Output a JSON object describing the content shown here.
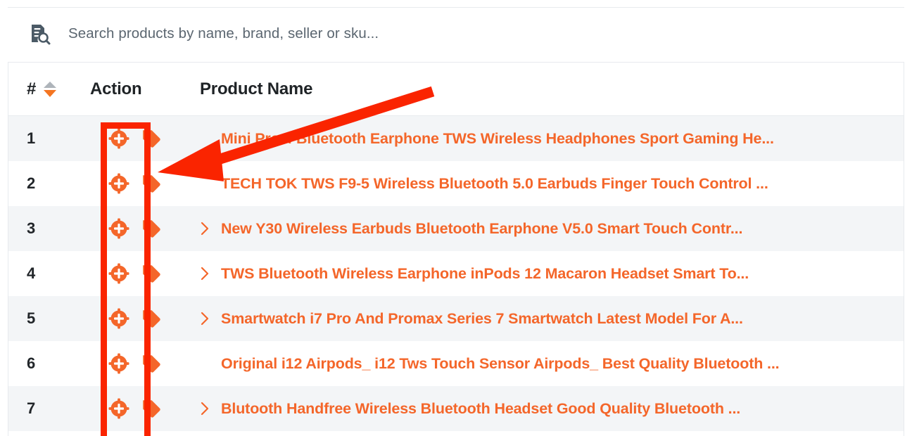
{
  "search": {
    "icon": "document-search-icon",
    "placeholder": "Search products by name, brand, seller or sku...",
    "value": ""
  },
  "table": {
    "columns": {
      "number": "#",
      "action": "Action",
      "product_name": "Product Name"
    },
    "sort": {
      "column": "#",
      "direction": "desc",
      "asc_color": "#aeb4ba",
      "desc_color": "#f47521"
    },
    "rows": [
      {
        "num": "1",
        "add_icon": "plus-circle-icon",
        "tag_icon": "tag-icon",
        "expandable": false,
        "name": "Mini Pro 4 Bluetooth Earphone TWS Wireless Headphones Sport Gaming He..."
      },
      {
        "num": "2",
        "add_icon": "plus-circle-icon",
        "tag_icon": "tag-icon",
        "expandable": false,
        "name": "TECH TOK TWS F9-5 Wireless Bluetooth 5.0 Earbuds Finger Touch Control ..."
      },
      {
        "num": "3",
        "add_icon": "plus-circle-icon",
        "tag_icon": "tag-icon",
        "expandable": true,
        "name": "New Y30 Wireless Earbuds Bluetooth Earphone V5.0 Smart Touch Contr..."
      },
      {
        "num": "4",
        "add_icon": "plus-circle-icon",
        "tag_icon": "tag-icon",
        "expandable": true,
        "name": "TWS Bluetooth Wireless Earphone inPods 12 Macaron Headset Smart To..."
      },
      {
        "num": "5",
        "add_icon": "plus-circle-icon",
        "tag_icon": "tag-icon",
        "expandable": true,
        "name": "Smartwatch i7 Pro And Promax Series 7 Smartwatch Latest Model For A..."
      },
      {
        "num": "6",
        "add_icon": "plus-circle-icon",
        "tag_icon": "tag-icon",
        "expandable": false,
        "name": "Original i12 Airpods_ i12 Tws Touch Sensor Airpods_ Best Quality Bluetooth ..."
      },
      {
        "num": "7",
        "add_icon": "plus-circle-icon",
        "tag_icon": "tag-icon",
        "expandable": true,
        "name": "Blutooth Handfree Wireless Bluetooth Headset Good Quality Bluetooth ..."
      }
    ]
  },
  "annotations": {
    "highlight_box": {
      "target": "action-column-add-buttons",
      "color": "#fa2400"
    },
    "arrow": {
      "points_to": "action-column-add-buttons",
      "color": "#fa2400"
    }
  },
  "colors": {
    "accent_orange": "#f4662a",
    "annotation_red": "#fa2400",
    "row_stripe": "#f3f5f7",
    "text_dark": "#22262a",
    "placeholder": "#5b6670"
  }
}
